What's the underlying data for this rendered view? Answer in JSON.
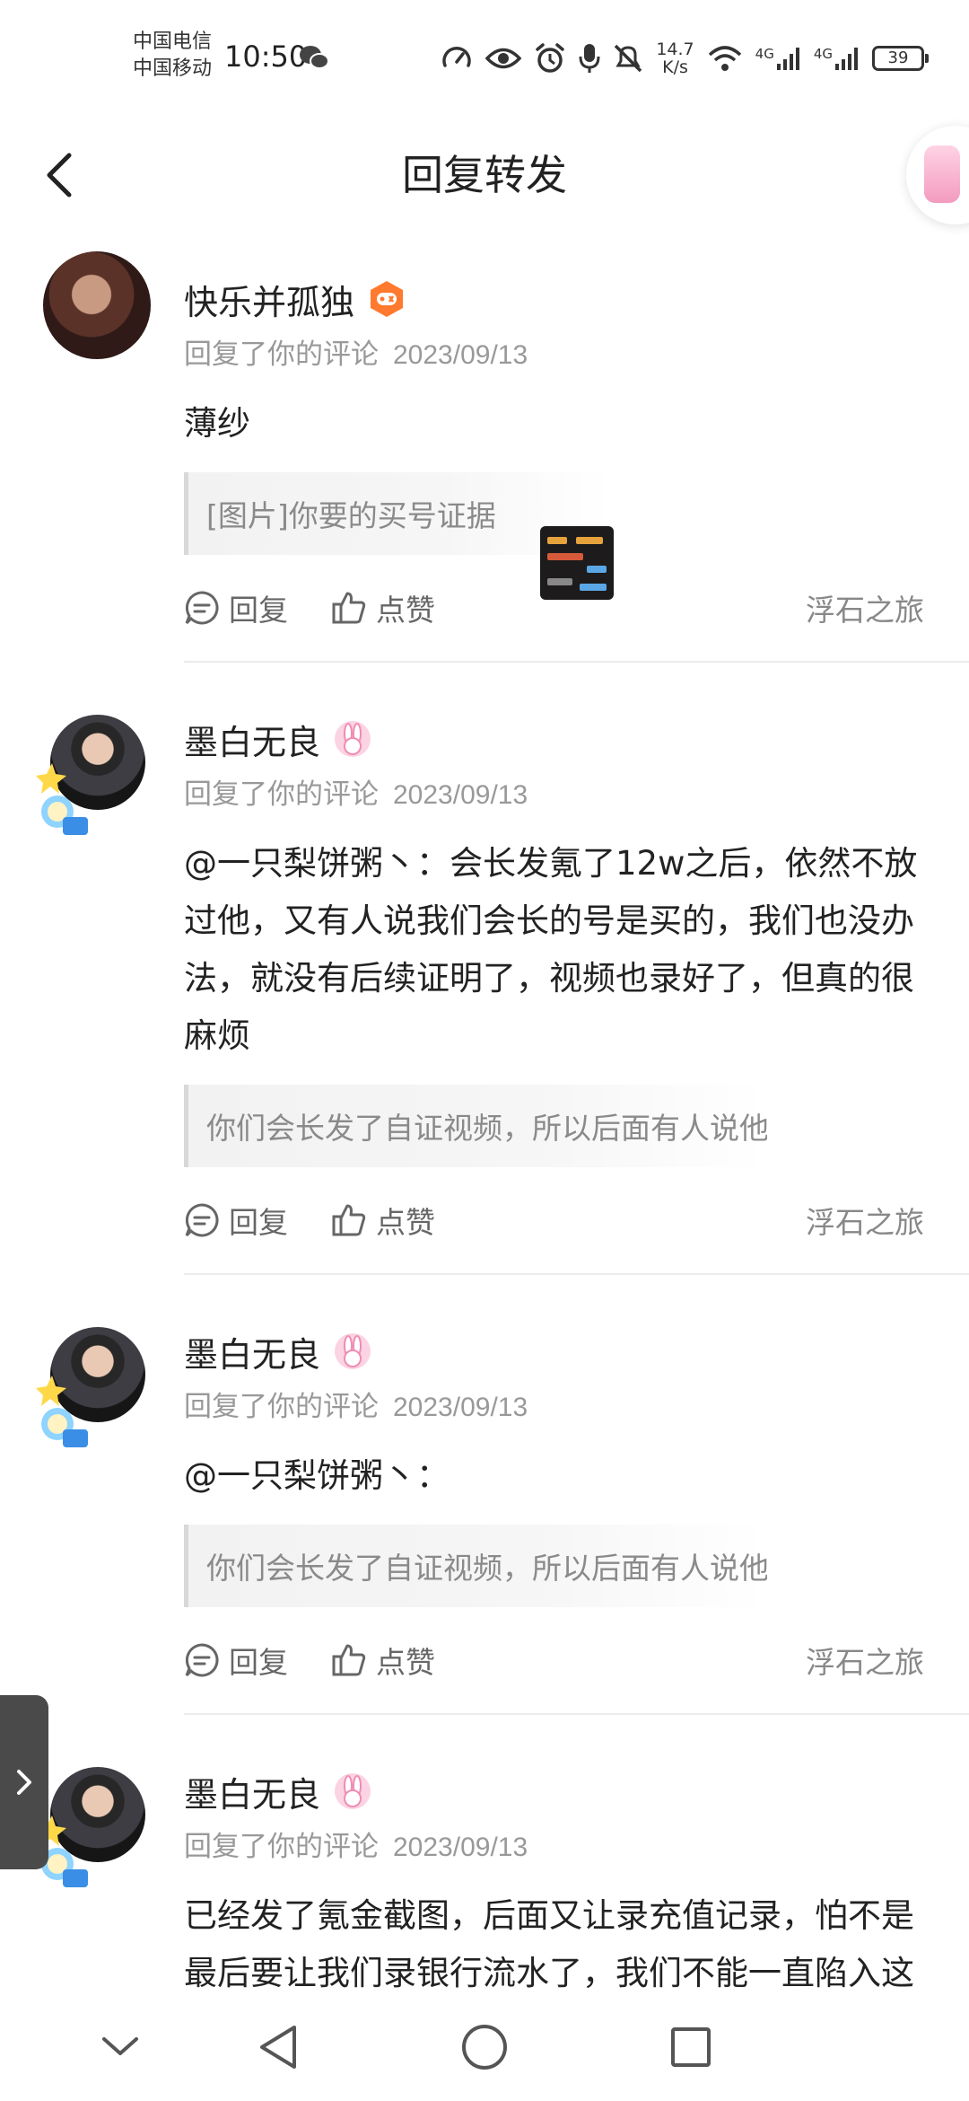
{
  "status_bar": {
    "carrier1": "中国电信",
    "carrier2": "中国移动",
    "time": "10:50",
    "net_speed_value": "14.7",
    "net_speed_unit": "K/s",
    "signal1_label": "4G",
    "signal2_label": "4G",
    "battery": "39"
  },
  "header": {
    "title": "回复转发"
  },
  "items": [
    {
      "username": "快乐并孤独",
      "action_text": "回复了你的评论",
      "date": "2023/09/13",
      "content": "薄纱",
      "quote": "[图片]你要的买号证据",
      "reply_label": "回复",
      "like_label": "点赞",
      "source": "浮石之旅"
    },
    {
      "username": "墨白无良",
      "action_text": "回复了你的评论",
      "date": "2023/09/13",
      "content": "@一只梨饼粥丶：会长发氪了12w之后，依然不放过他，又有人说我们会长的号是买的，我们也没办法，就没有后续证明了，视频也录好了，但真的很麻烦",
      "quote": "你们会长发了自证视频，所以后面有人说他刷…",
      "reply_label": "回复",
      "like_label": "点赞",
      "source": "浮石之旅"
    },
    {
      "username": "墨白无良",
      "action_text": "回复了你的评论",
      "date": "2023/09/13",
      "content": "@一只梨饼粥丶：",
      "quote": "你们会长发了自证视频，所以后面有人说他刷…",
      "reply_label": "回复",
      "like_label": "点赞",
      "source": "浮石之旅"
    },
    {
      "username": "墨白无良",
      "action_text": "回复了你的评论",
      "date": "2023/09/13",
      "content": "已经发了氪金截图，后面又让录充值记录，怕不是最后要让我们录银行流水了，我们不能一直陷入这种自证漩涡，说始末"
    }
  ],
  "icons": {
    "back": "chevron-left-icon",
    "reply": "comment-bubble-icon",
    "like": "thumbs-up-icon",
    "nav_down": "chevron-down-icon",
    "nav_back": "triangle-back-icon",
    "nav_home": "circle-home-icon",
    "nav_recent": "square-recent-icon"
  },
  "colors": {
    "badge_orange": "#ff7a2e",
    "badge_pink": "#f6a9c6",
    "secondary_text": "#999999"
  }
}
